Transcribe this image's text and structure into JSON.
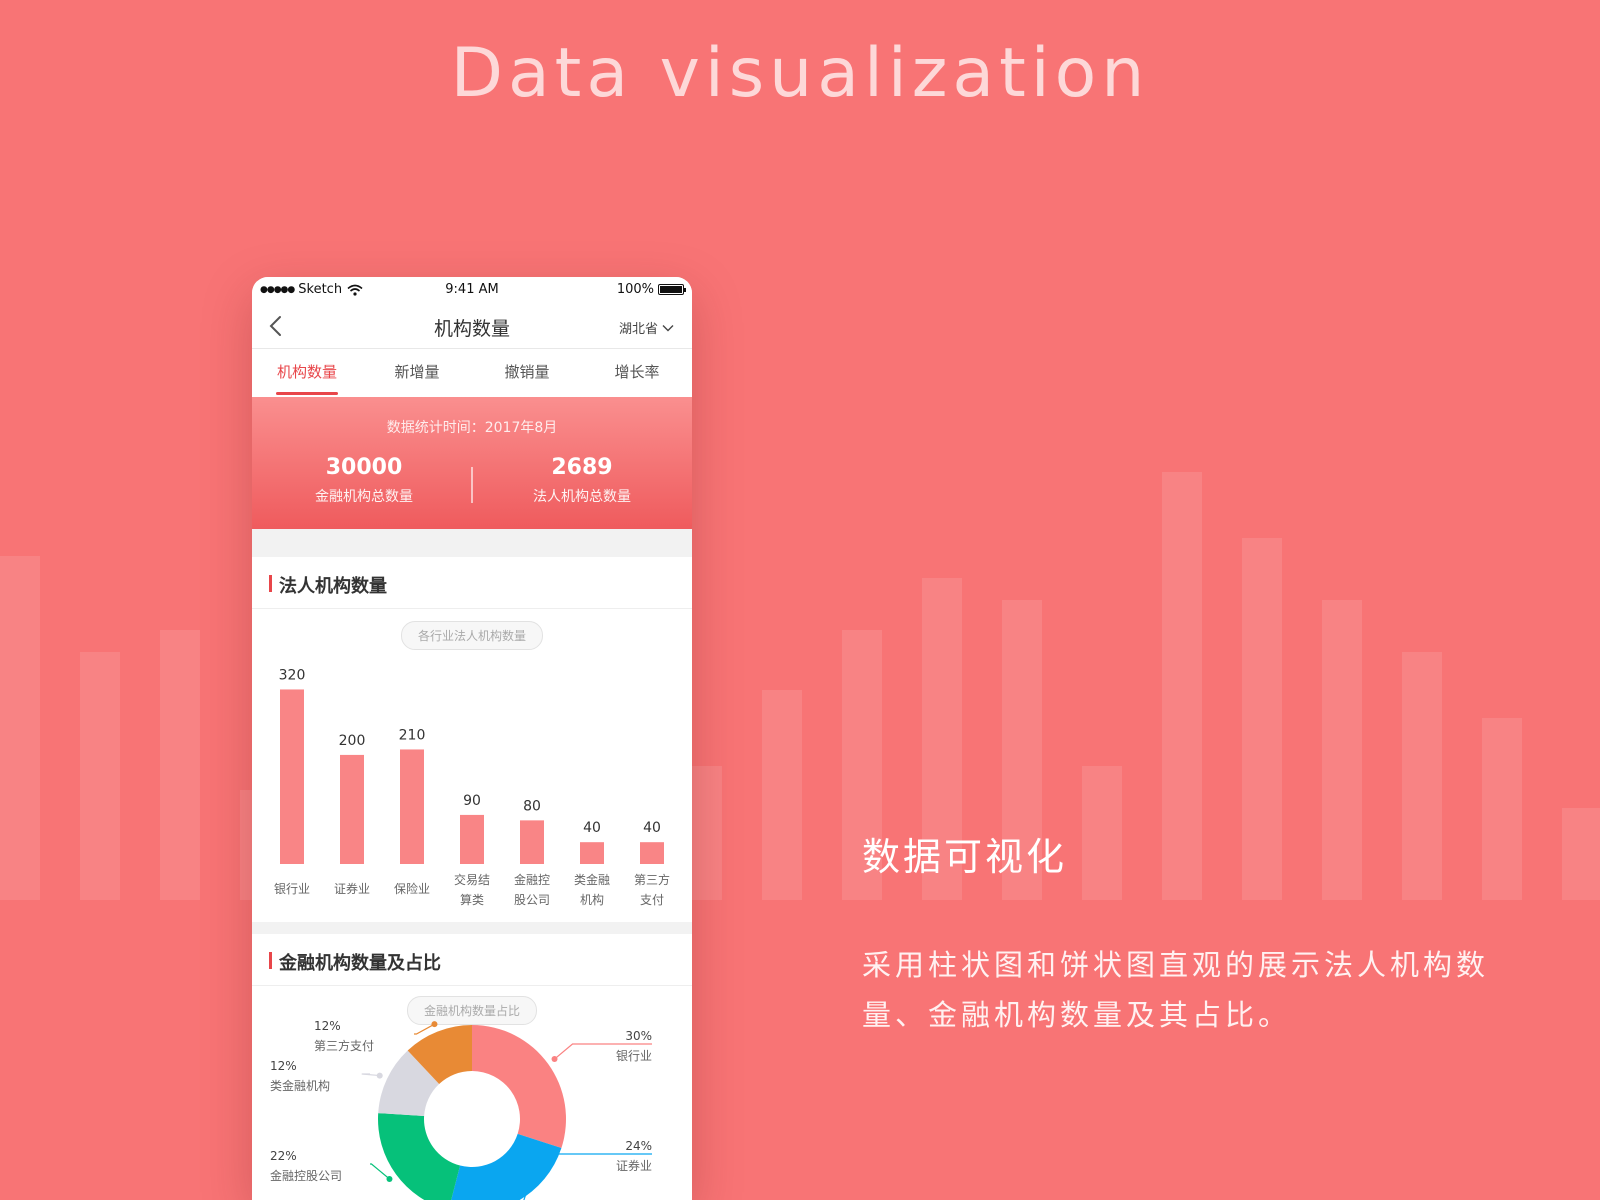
{
  "hero": {
    "title": "Data visualization"
  },
  "side": {
    "title": "数据可视化",
    "description": "采用柱状图和饼状图直观的展示法人机构数量、金融机构数量及其占比。"
  },
  "statusbar": {
    "carrier": "Sketch",
    "time": "9:41 AM",
    "battery": "100%"
  },
  "navbar": {
    "title": "机构数量",
    "region": "湖北省"
  },
  "tabs": [
    {
      "label": "机构数量",
      "active": true
    },
    {
      "label": "新增量",
      "active": false
    },
    {
      "label": "撤销量",
      "active": false
    },
    {
      "label": "增长率",
      "active": false
    }
  ],
  "summary": {
    "time": "数据统计时间：2017年8月",
    "stats": [
      {
        "value": "30000",
        "label": "金融机构总数量"
      },
      {
        "value": "2689",
        "label": "法人机构总数量"
      }
    ]
  },
  "bar_section": {
    "title": "法人机构数量",
    "pill": "各行业法人机构数量"
  },
  "pie_section": {
    "title": "金融机构数量及占比",
    "pill": "金融机构数量占比"
  },
  "colors": {
    "accent": "#e8464a",
    "bar": "#f98586",
    "background": "#f87475"
  },
  "chart_data": [
    {
      "type": "bar",
      "title": "各行业法人机构数量",
      "categories": [
        [
          "银行业"
        ],
        [
          "证券业"
        ],
        [
          "保险业"
        ],
        [
          "交易结",
          "算类"
        ],
        [
          "金融控",
          "股公司"
        ],
        [
          "类金融",
          "机构"
        ],
        [
          "第三方",
          "支付"
        ]
      ],
      "values": [
        320,
        200,
        210,
        90,
        80,
        40,
        40
      ],
      "ylim": [
        0,
        330
      ],
      "grid": false
    },
    {
      "type": "pie",
      "title": "金融机构数量占比",
      "donut": true,
      "slices": [
        {
          "label": "银行业",
          "value": 30,
          "text": "30%",
          "color": "#fa8282"
        },
        {
          "label": "证券业",
          "value": 24,
          "text": "24%",
          "color": "#0aa6f0"
        },
        {
          "label": "",
          "value": 0,
          "text": "",
          "color": "#1f2a5a"
        },
        {
          "label": "金融控股公司",
          "value": 22,
          "text": "22%",
          "color": "#06c17a"
        },
        {
          "label": "类金融机构",
          "value": 12,
          "text": "12%",
          "color": "#d8d8e0"
        },
        {
          "label": "第三方支付",
          "value": 12,
          "text": "12%",
          "color": "#e88a35"
        }
      ]
    }
  ]
}
